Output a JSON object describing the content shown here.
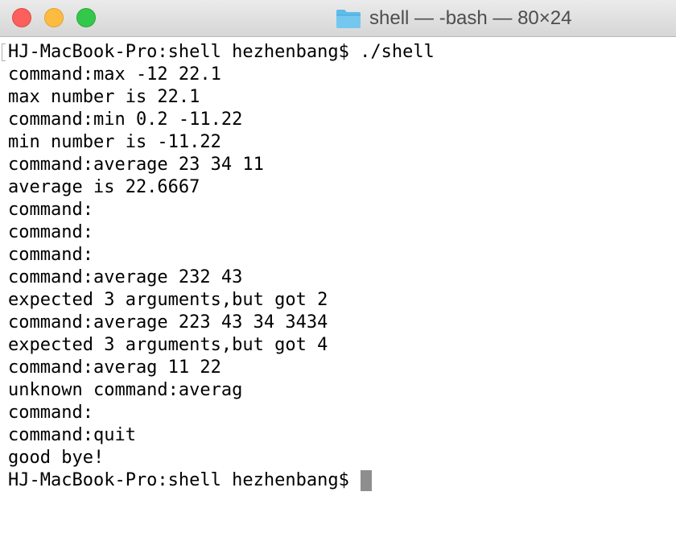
{
  "window": {
    "title": "shell — -bash — 80×24",
    "folder_icon": "folder-icon",
    "colors": {
      "close": "#fc605c",
      "minimize": "#fdbc40",
      "zoom": "#34c84a",
      "folder": "#5fbbe9"
    }
  },
  "terminal": {
    "lines": [
      "HJ-MacBook-Pro:shell hezhenbang$ ./shell",
      "command:max -12 22.1",
      "max number is 22.1",
      "command:min 0.2 -11.22",
      "min number is -11.22",
      "command:average 23 34 11",
      "average is 22.6667",
      "command:",
      "command:",
      "command:",
      "command:average 232 43",
      "expected 3 arguments,but got 2",
      "command:average 223 43 34 3434",
      "expected 3 arguments,but got 4",
      "command:averag 11 22",
      "unknown command:averag",
      "command:",
      "command:quit",
      "good bye!"
    ],
    "prompt": "HJ-MacBook-Pro:shell hezhenbang$ "
  }
}
